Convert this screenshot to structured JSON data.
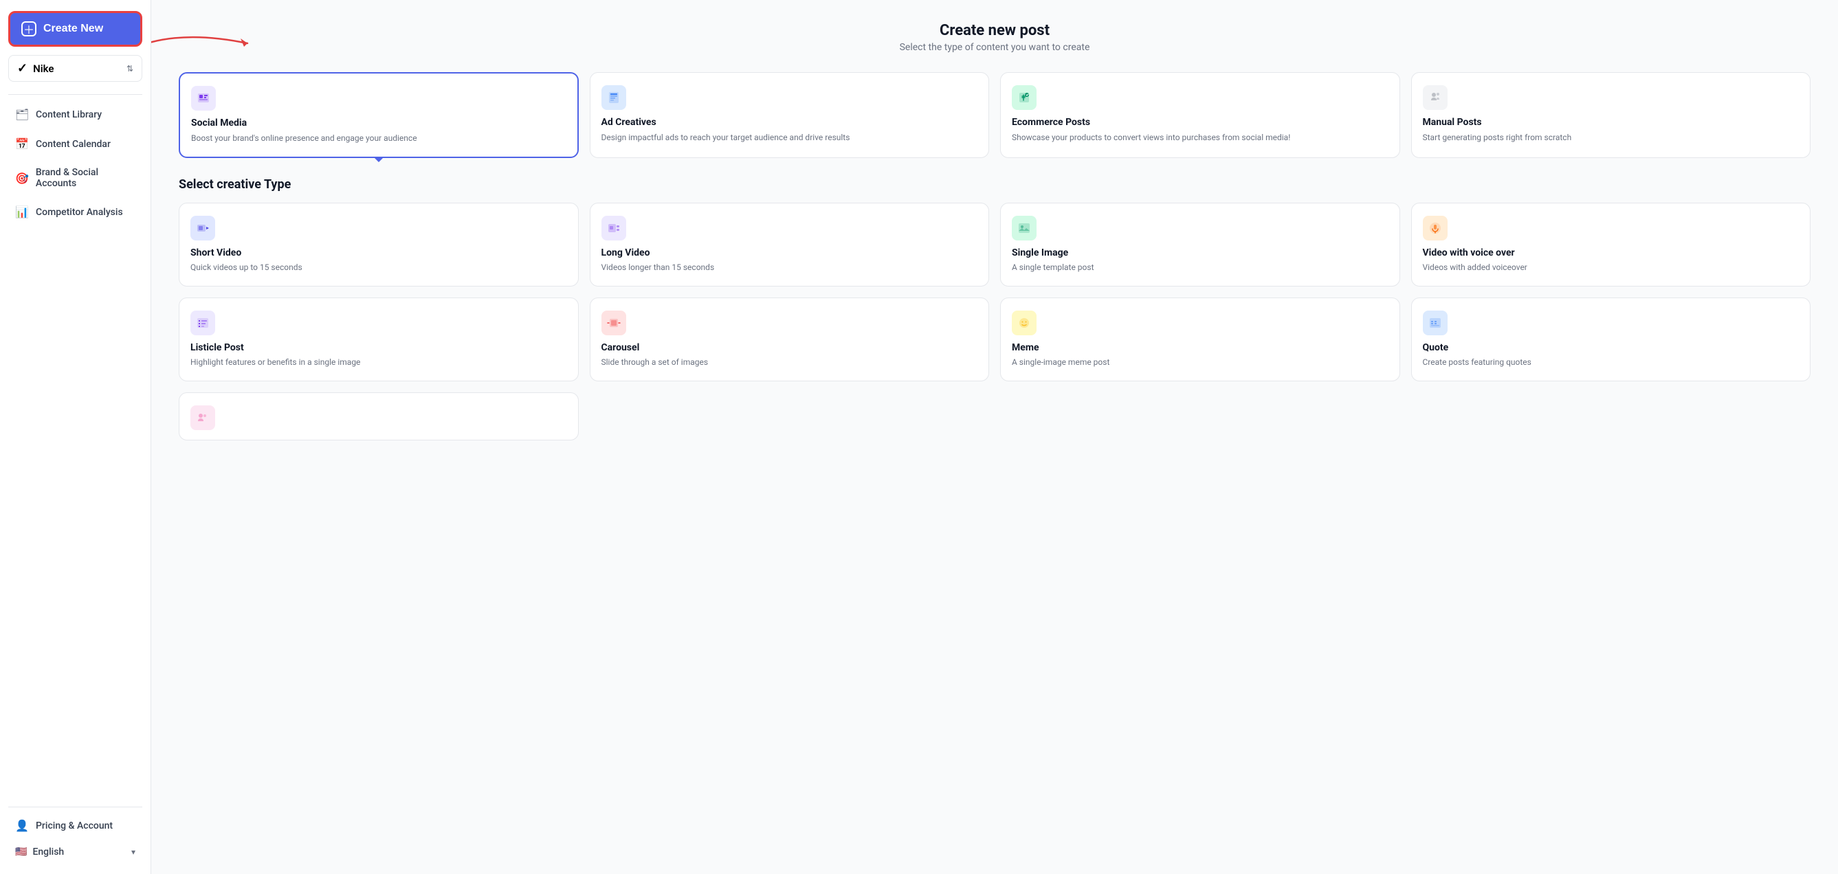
{
  "sidebar": {
    "create_new_label": "Create New",
    "brand": {
      "name": "Nike",
      "logo": "✔"
    },
    "nav_items": [
      {
        "id": "content-library",
        "label": "Content Library",
        "icon": "🗂"
      },
      {
        "id": "content-calendar",
        "label": "Content Calendar",
        "icon": "📅"
      },
      {
        "id": "brand-social",
        "label": "Brand & Social Accounts",
        "icon": "🎯"
      },
      {
        "id": "competitor-analysis",
        "label": "Competitor Analysis",
        "icon": "📊"
      }
    ],
    "bottom": {
      "pricing_label": "Pricing & Account",
      "lang_label": "English"
    }
  },
  "main": {
    "page_title": "Create new post",
    "page_subtitle": "Select the type of content you want to create",
    "type_cards": [
      {
        "id": "social-media",
        "title": "Social Media",
        "desc": "Boost your brand's online presence and engage your audience",
        "icon": "📋",
        "icon_bg": "bg-purple-light",
        "selected": true
      },
      {
        "id": "ad-creatives",
        "title": "Ad Creatives",
        "desc": "Design impactful ads to reach your target audience and drive results",
        "icon": "📄",
        "icon_bg": "bg-blue-light",
        "selected": false
      },
      {
        "id": "ecommerce-posts",
        "title": "Ecommerce Posts",
        "desc": "Showcase your products to convert views into purchases from social media!",
        "icon": "🛒",
        "icon_bg": "bg-green-light",
        "selected": false
      },
      {
        "id": "manual-posts",
        "title": "Manual Posts",
        "desc": "Start generating posts right from scratch",
        "icon": "✏️",
        "icon_bg": "bg-gray-light",
        "selected": false
      }
    ],
    "section_title": "Select creative Type",
    "creative_cards_row1": [
      {
        "id": "short-video",
        "title": "Short Video",
        "desc": "Quick videos up to 15 seconds",
        "icon": "🎬",
        "icon_bg": "bg-indigo-light"
      },
      {
        "id": "long-video",
        "title": "Long Video",
        "desc": "Videos longer than 15 seconds",
        "icon": "🎞",
        "icon_bg": "bg-purple-light"
      },
      {
        "id": "single-image",
        "title": "Single Image",
        "desc": "A single template post",
        "icon": "🖼",
        "icon_bg": "bg-green-light"
      },
      {
        "id": "voice-over",
        "title": "Video with voice over",
        "desc": "Videos with added voiceover",
        "icon": "🎙",
        "icon_bg": "bg-orange-light"
      }
    ],
    "creative_cards_row2": [
      {
        "id": "listicle-post",
        "title": "Listicle Post",
        "desc": "Highlight features or benefits in a single image",
        "icon": "☑",
        "icon_bg": "bg-purple-light"
      },
      {
        "id": "carousel",
        "title": "Carousel",
        "desc": "Slide through a set of images",
        "icon": "🔖",
        "icon_bg": "bg-red-light"
      },
      {
        "id": "meme",
        "title": "Meme",
        "desc": "A single-image meme post",
        "icon": "😊",
        "icon_bg": "bg-yellow-light"
      },
      {
        "id": "quote",
        "title": "Quote",
        "desc": "Create posts featuring quotes",
        "icon": "📊",
        "icon_bg": "bg-blue-light"
      }
    ],
    "partial_card": {
      "icon": "👥",
      "icon_bg": "bg-pink-light"
    }
  }
}
